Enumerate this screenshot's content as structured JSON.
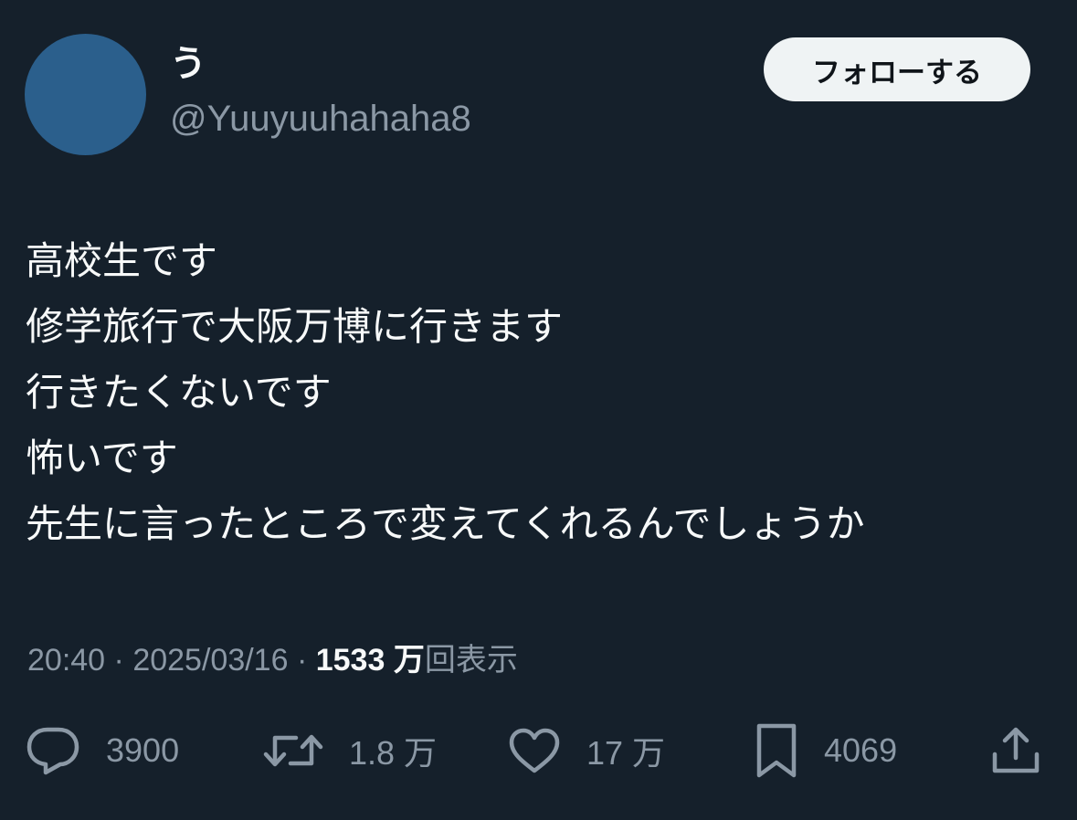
{
  "author": {
    "display_name": "う",
    "handle": "@Yuuyuuhahaha8",
    "avatar_color": "#2b5f8c"
  },
  "follow_button": {
    "label": "フォローする"
  },
  "tweet": {
    "lines": [
      "高校生です",
      "修学旅行で大阪万博に行きます",
      "行きたくないです",
      "怖いです",
      "先生に言ったところで変えてくれるんでしょうか"
    ]
  },
  "meta": {
    "time": "20:40",
    "separator": "·",
    "date": "2025/03/16",
    "views_count": "1533 万",
    "views_label": "回表示"
  },
  "actions": {
    "reply": {
      "icon": "reply-icon",
      "count": "3900"
    },
    "retweet": {
      "icon": "retweet-icon",
      "count": "1.8 万"
    },
    "like": {
      "icon": "heart-icon",
      "count": "17 万"
    },
    "bookmark": {
      "icon": "bookmark-icon",
      "count": "4069"
    },
    "share": {
      "icon": "share-icon"
    }
  },
  "colors": {
    "background": "#15202b",
    "text_primary": "#f7f9f9",
    "text_secondary": "#8b98a5",
    "follow_bg": "#eff3f4"
  }
}
